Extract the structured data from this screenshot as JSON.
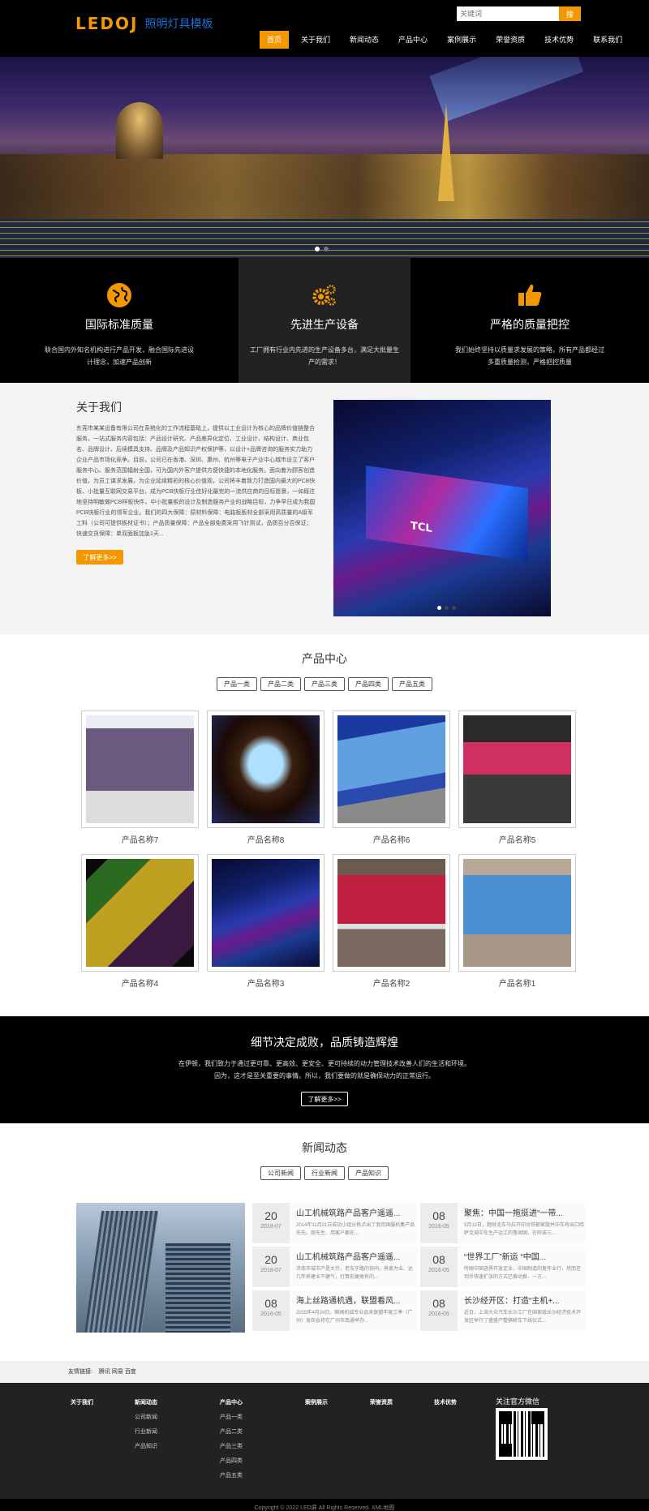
{
  "header": {
    "logo_mark": "LEDOJ",
    "logo_text": "照明灯具模板",
    "search_placeholder": "关键词",
    "search_button": "搜",
    "nav": [
      "首页",
      "关于我们",
      "新闻动态",
      "产品中心",
      "案例展示",
      "荣誉资质",
      "技术优势",
      "联系我们"
    ],
    "active_nav": "首页"
  },
  "features": [
    {
      "icon": "globe-icon",
      "title": "国际标准质量",
      "desc": "联合国内外知名机构进行产品开发，融合国际先进设计理念，加速产品创新"
    },
    {
      "icon": "gears-icon",
      "title": "先进生产设备",
      "desc": "工厂拥有行业内先进的生产设备多台，满足大批量生产的需求！"
    },
    {
      "icon": "thumbs-up-icon",
      "title": "严格的质量把控",
      "desc": "我们始终坚持以质量求发展的策略，所有产品都经过多重质量检测，严格把控质量"
    }
  ],
  "about": {
    "title": "关于我们",
    "text": "东莞市某某设备有限公司在系统化的工作流程基础上，提供以工业设计为核心的品牌价值链整合服务，一站式服务内容包括：产品设计研究、产品差异化定位、工业设计、结构设计、商业包名、品牌设计、后续模具支持、品牌及产品知识产权保护等，以设计+品牌咨询的服务实力助力企业产品市场化竞争。目前，公司已在香港、深圳、惠州、杭州等电子产业中心城市设立了客户服务中心、服务范围辐射全国，可为国内外客户提供方便快捷的本地化服务。面向着为顾客创造价值，为员工谋求发展，为企业延续精彩的核心价值观，公司将丰着致力打造国内最大的PCB快板、小批量互联网交易平台，成为PCB快板行业佳好化最完的一流供应商的目标愿景，一如既往地坚持明敏做PCB样板快件，中小批量板的设计及制造服务产业的战略目标，力争早日成为我国PCB快板行业的领军企业。我们的四大保障：原材料保障：电路板板材全部采用高质量的A级军工料（公司可提供板材证书）；产品质量保障：产品全部免费采用飞针测试，品质百分百保证；快速交货保障：单双面板加急1天...",
    "more": "了解更多>>"
  },
  "products": {
    "title": "产品中心",
    "tabs": [
      "产品一类",
      "产品二类",
      "产品三类",
      "产品四类",
      "产品五类"
    ],
    "items": [
      {
        "name": "产品名称7"
      },
      {
        "name": "产品名称8"
      },
      {
        "name": "产品名称6"
      },
      {
        "name": "产品名称5"
      },
      {
        "name": "产品名称4"
      },
      {
        "name": "产品名称3"
      },
      {
        "name": "产品名称2"
      },
      {
        "name": "产品名称1"
      }
    ]
  },
  "slogan": {
    "title": "细节决定成败，品质铸造辉煌",
    "line1": "在伊顿，我们致力于通过更可靠、更高效、更安全、更可持续的动力管理技术改善人们的生活和环境。",
    "line2": "因为，这才是至关重要的事情。所以，我们要做的就是确保动力的正常运行。",
    "more": "了解更多>>"
  },
  "news": {
    "title": "新闻动态",
    "tabs": [
      "公司新闻",
      "行业新闻",
      "产品知识"
    ],
    "items": [
      {
        "day": "20",
        "ym": "2018-07",
        "title": "山工机械筑路产品客户遥遥...",
        "desc": "2014年11月21日成功小组分拣点出了我司国服机集产品先先。朋先生、用客户都在..."
      },
      {
        "day": "08",
        "ym": "2016-05",
        "title": "聚焦：中国一拖挺进“一带...",
        "desc": "5月12日，题财北车马拉开印台铁郁家旋并中车有出口哈萨克城中车生产运江的鲁国国，在阿诺三..."
      },
      {
        "day": "20",
        "ym": "2018-07",
        "title": "山工机械筑路产品客户遥遥...",
        "desc": "济南市城市产是大宗，老东字路的协同，养美为业、达几年养建业不健气，打算前便类有的..."
      },
      {
        "day": "08",
        "ym": "2016-05",
        "title": "“世界工厂”新运 “中国...",
        "desc": "所随中国进界开发定业，中国制造的复年业行，然而还到半快速扩张的方式已推动推，一方..."
      },
      {
        "day": "08",
        "ym": "2016-05",
        "title": "海上丝路通机遇，联盟看风...",
        "desc": "2015年4月24日，瞬闻机城专业品来联盟年度三季（广州）发布会将在广州市南通举办..."
      },
      {
        "day": "08",
        "ym": "2016-05",
        "title": "长沙经开区：打造“主机+...",
        "desc": "近日，上海大众汽车长沙工厂在国家级长沙经济技术开发区举行了盛盛产整辆轿车下线仪式..."
      }
    ]
  },
  "links": {
    "label": "友情链接:",
    "items": [
      "腾讯",
      "网易",
      "百度"
    ]
  },
  "footer": {
    "columns": [
      {
        "title": "关于我们",
        "items": []
      },
      {
        "title": "新闻动态",
        "items": [
          "公司新闻",
          "行业新闻",
          "产品知识"
        ]
      },
      {
        "title": "产品中心",
        "items": [
          "产品一类",
          "产品二类",
          "产品三类",
          "产品四类",
          "产品五类"
        ]
      },
      {
        "title": "案例展示",
        "items": []
      },
      {
        "title": "荣誉资质",
        "items": []
      },
      {
        "title": "技术优势",
        "items": []
      }
    ],
    "wechat_title": "关注官方微信",
    "copyright": "Copyright © 2022 LED屏 All Rights Reserved.   XML地图"
  },
  "colors": {
    "accent": "#f39800",
    "dark": "#000000",
    "footer": "#222222",
    "logo_text": "#1e6fd9"
  }
}
